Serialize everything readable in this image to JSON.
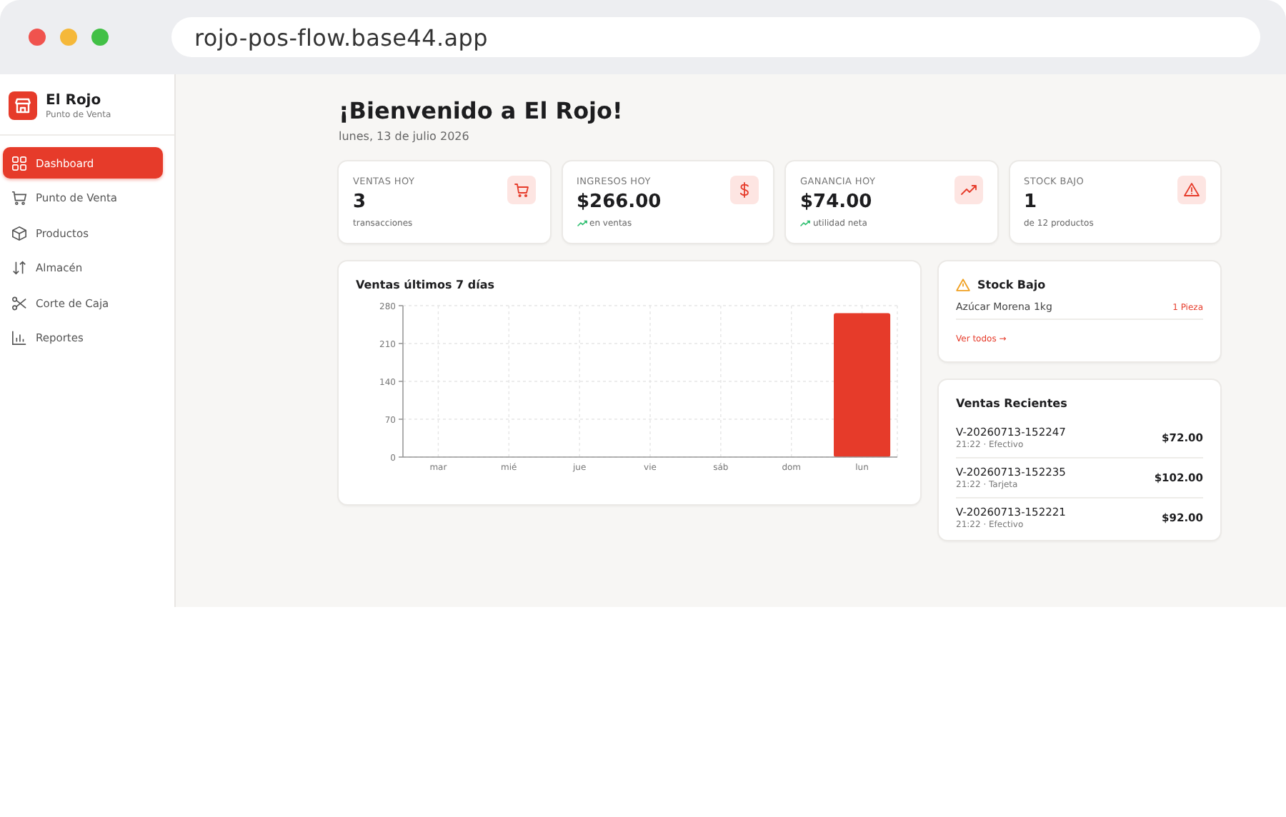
{
  "browser": {
    "url": "rojo-pos-flow.base44.app"
  },
  "sidebar": {
    "brand": "El Rojo",
    "subtitle": "Punto de Venta",
    "items": [
      {
        "label": "Dashboard",
        "selected": true
      },
      {
        "label": "Punto de Venta",
        "selected": false
      },
      {
        "label": "Productos",
        "selected": false
      },
      {
        "label": "Almacén",
        "selected": false
      },
      {
        "label": "Corte de Caja",
        "selected": false
      },
      {
        "label": "Reportes",
        "selected": false
      }
    ]
  },
  "header": {
    "title": "¡Bienvenido a El Rojo!",
    "date": "lunes, 13 de julio 2026"
  },
  "stats": [
    {
      "label": "VENTAS HOY",
      "value": "3",
      "note": "transacciones",
      "trend_up": false
    },
    {
      "label": "INGRESOS HOY",
      "value": "$266.00",
      "note": "en ventas",
      "trend_up": true
    },
    {
      "label": "GANANCIA HOY",
      "value": "$74.00",
      "note": "utilidad neta",
      "trend_up": true
    },
    {
      "label": "STOCK BAJO",
      "value": "1",
      "note": "de 12 productos",
      "trend_up": false
    }
  ],
  "sales_chart": {
    "chart_data": {
      "type": "bar",
      "title": "Ventas últimos 7 días",
      "categories": [
        "mar",
        "mié",
        "jue",
        "vie",
        "sáb",
        "dom",
        "lun"
      ],
      "values": [
        0,
        0,
        0,
        0,
        0,
        0,
        266
      ],
      "grid": true,
      "ylim": [
        0,
        280
      ],
      "yticks": [
        0,
        70,
        140,
        210,
        280
      ]
    }
  },
  "low_stock": {
    "title": "Stock Bajo",
    "items": [
      {
        "name": "Azúcar Morena 1kg",
        "quantity": "1 Pieza"
      }
    ],
    "link": "Ver todos →"
  },
  "recent_sales": {
    "title": "Ventas Recientes",
    "items": [
      {
        "id": "V-20260713-152247",
        "meta": "21:22 · Efectivo",
        "amount": "$72.00"
      },
      {
        "id": "V-20260713-152235",
        "meta": "21:22 · Tarjeta",
        "amount": "$102.00"
      },
      {
        "id": "V-20260713-152221",
        "meta": "21:22 · Efectivo",
        "amount": "$92.00"
      }
    ]
  }
}
